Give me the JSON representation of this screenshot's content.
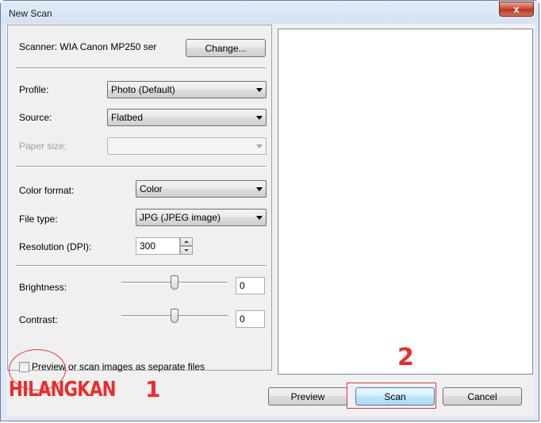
{
  "window": {
    "title": "New Scan",
    "close_label": "x"
  },
  "scanner": {
    "label": "Scanner: WIA Canon MP250 ser",
    "change_button": "Change..."
  },
  "fields": {
    "profile": {
      "label": "Profile:",
      "value": "Photo (Default)"
    },
    "source": {
      "label": "Source:",
      "value": "Flatbed"
    },
    "paper_size": {
      "label": "Paper size:",
      "value": ""
    },
    "color_format": {
      "label": "Color format:",
      "value": "Color"
    },
    "file_type": {
      "label": "File type:",
      "value": "JPG (JPEG image)"
    },
    "resolution": {
      "label": "Resolution (DPI):",
      "value": "300"
    },
    "brightness": {
      "label": "Brightness:",
      "value": "0",
      "slider_level": 0.5
    },
    "contrast": {
      "label": "Contrast:",
      "value": "0",
      "slider_level": 0.5
    }
  },
  "checkbox": {
    "label": "Preview or scan images as separate files",
    "checked": false
  },
  "buttons": {
    "preview": "Preview",
    "scan": "Scan",
    "cancel": "Cancel"
  },
  "annotations": {
    "remove_label": "HILANGKAN",
    "step_one": "1",
    "step_two": "2",
    "color": "#ee2b2b"
  }
}
